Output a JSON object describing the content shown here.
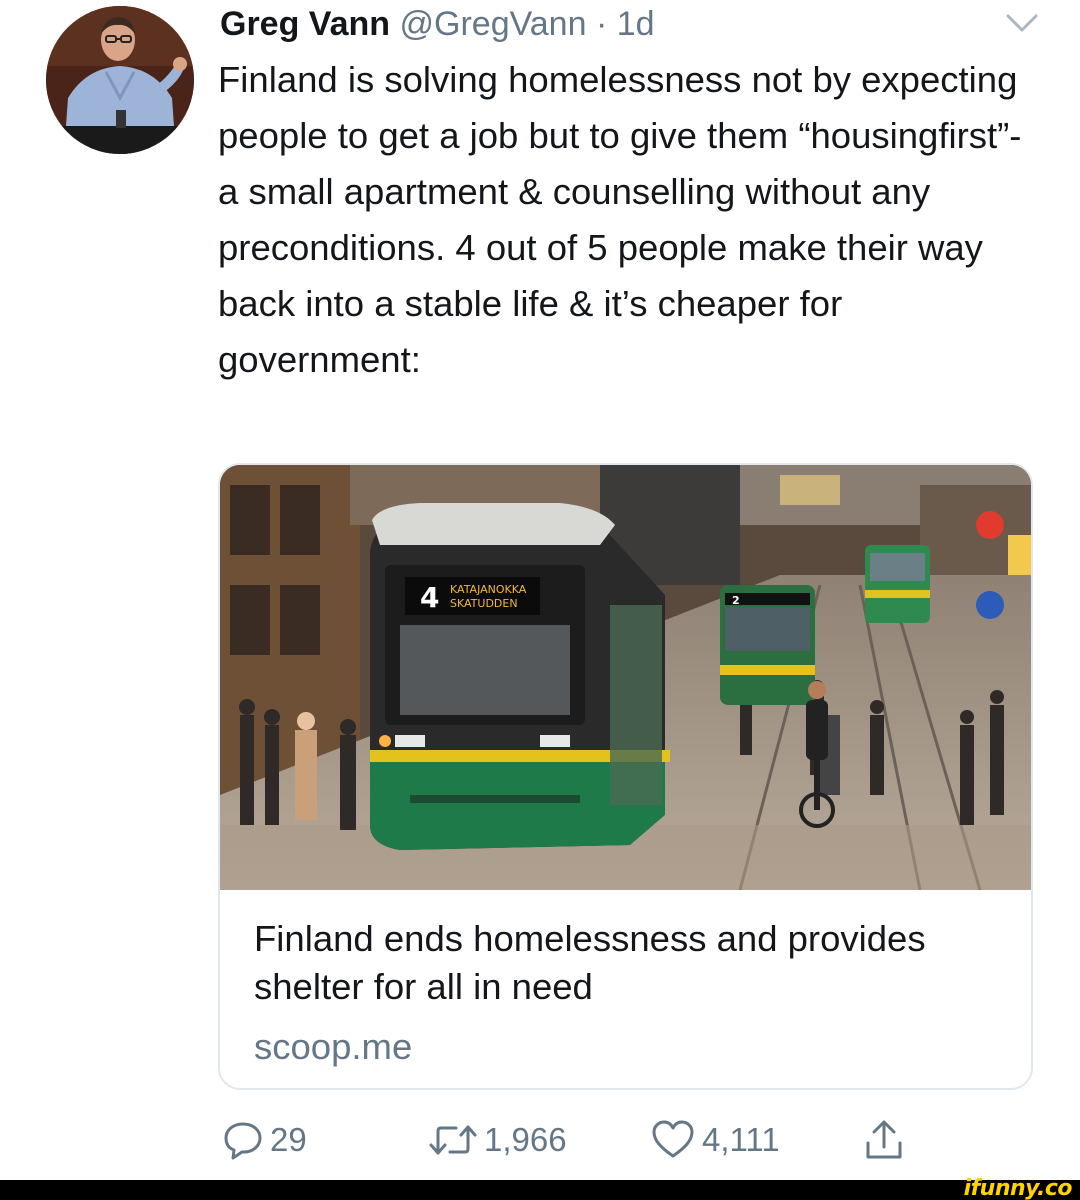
{
  "tweet": {
    "display_name": "Greg Vann",
    "handle": "@GregVann",
    "separator": "·",
    "time": "1d",
    "text": "Finland is solving homelessness not by expecting people to get a job but to give them “housingfirst”- a small apartment & counselling without any preconditions. 4 out of 5 people make their way back into a stable life & it’s cheaper for government:"
  },
  "card": {
    "title": "Finland ends homelessness and provides shelter for all in need",
    "domain": "scoop.me",
    "tram_sign_number": "4",
    "tram_sign_line1": "KATAJANOKKA",
    "tram_sign_line2": "SKATUDDEN",
    "tram2_number": "2"
  },
  "actions": {
    "replies": "29",
    "retweets": "1,966",
    "likes": "4,111"
  },
  "icons": {
    "avatar": "user-avatar",
    "caret": "chevron-down-icon",
    "reply": "reply-icon",
    "retweet": "retweet-icon",
    "like": "heart-icon",
    "share": "share-icon"
  },
  "colors": {
    "text_primary": "#14171a",
    "text_secondary": "#657786",
    "card_border": "#e1e8ed",
    "tram_green": "#1f7a4a",
    "tram_yellow": "#e3c21c",
    "watermark": "#ffd300"
  },
  "watermark": "ifunny.co"
}
